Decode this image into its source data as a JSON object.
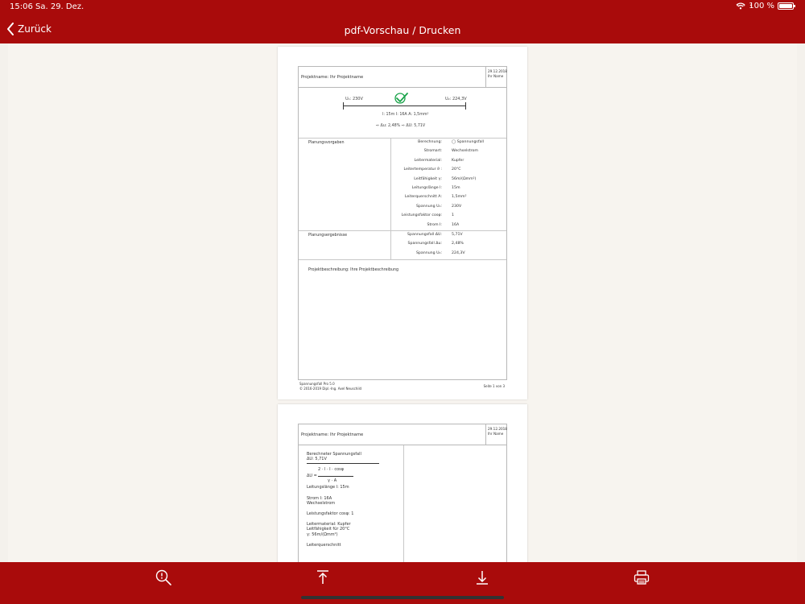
{
  "status": {
    "time": "15:06",
    "date": "Sa. 29. Dez.",
    "battery": "100 %",
    "battery_level": 1.0,
    "dots": "• • •"
  },
  "nav": {
    "back_label": "Zurück",
    "title": "pdf-Vorschau / Drucken"
  },
  "page1": {
    "header_project": "Projektname:  Ihr Projektname",
    "header_date": "29.12.2018",
    "header_name": "Ihr Name",
    "diagram": {
      "u1": "U₁: 230V",
      "u2": "U₂: 224,3V",
      "params": "l: 15m    I: 16A    A: 1,5mm²",
      "results": "⇨ Δu: 2,48%     ⇨ ΔU: 5,71V"
    },
    "planning_given_title": "Planungsvorgaben",
    "given_rows": [
      {
        "label": "Berechnung:",
        "value": "◯ Spannungsfall"
      },
      {
        "label": "Stromart:",
        "value": "Wechselstrom"
      },
      {
        "label": "Leitermaterial:",
        "value": "Kupfer"
      },
      {
        "label": "Leitertemperatur ϑ :",
        "value": "20°C"
      },
      {
        "label": "Leitfähigkeit γ:",
        "value": "56m/(Ωmm²)"
      },
      {
        "label": "Leitungslänge l:",
        "value": "15m"
      },
      {
        "label": "Leiterquerschnitt A:",
        "value": "1,5mm²"
      },
      {
        "label": "Spannung U₁:",
        "value": "230V"
      },
      {
        "label": "Leistungsfaktor cosφ:",
        "value": "1"
      },
      {
        "label": "Strom I:",
        "value": "16A"
      }
    ],
    "planning_results_title": "Planungsergebnisse",
    "result_rows": [
      {
        "label": "Spannungsfall ΔU:",
        "value": "5,71V"
      },
      {
        "label": "Spannungsfall Δu:",
        "value": "2,48%"
      },
      {
        "label": "Spannung U₂:",
        "value": "224,3V"
      }
    ],
    "description": "Projektbeschreibung:  Ihre Projektbeschreibung",
    "footer_app": "Spannungsfall Pro 5.0",
    "footer_copyright": "© 2016-2019 Dipl.-Ing. Axel Neuschild",
    "footer_page": "Seite 1 von 3"
  },
  "page2": {
    "header_project": "Projektname:  Ihr Projektname",
    "header_date": "29.12.2018",
    "header_name": "Ihr Name",
    "calc_title": "Berechneter Spannungsfall",
    "calc_value": "ΔU: 5,71V",
    "formula_num": "2 · l · I · cosφ",
    "formula_eq": "ΔU =",
    "formula_den": "γ · A",
    "length": "Leitungslänge l: 15m",
    "current": "Strom I: 16A",
    "current_type": "Wechselstrom",
    "power_factor": "Leistungsfaktor cosφ: 1",
    "material": "Leitermaterial: Kupfer",
    "conductivity": "Leitfähigkeit für 20°C",
    "conductivity_val": "γ: 56m/(Ωmm²)",
    "cross_section": "Leiterquerschnitt"
  },
  "toolbar": {
    "zoom_icon": "zoom-icon",
    "top_icon": "scroll-to-top-icon",
    "download_icon": "download-icon",
    "print_icon": "print-icon"
  },
  "colors": {
    "brand": "#a90b0b",
    "check": "#1aa34a"
  }
}
